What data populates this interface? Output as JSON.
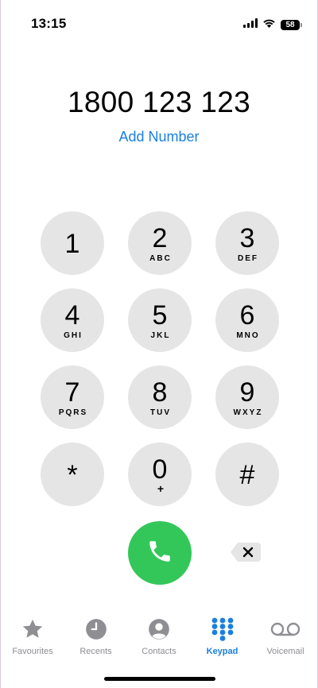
{
  "status_bar": {
    "time": "13:15",
    "battery": "58"
  },
  "dialer": {
    "number": "1800 123 123",
    "add_number_label": "Add Number"
  },
  "keypad": {
    "keys": [
      {
        "digit": "1",
        "letters": ""
      },
      {
        "digit": "2",
        "letters": "ABC"
      },
      {
        "digit": "3",
        "letters": "DEF"
      },
      {
        "digit": "4",
        "letters": "GHI"
      },
      {
        "digit": "5",
        "letters": "JKL"
      },
      {
        "digit": "6",
        "letters": "MNO"
      },
      {
        "digit": "7",
        "letters": "PQRS"
      },
      {
        "digit": "8",
        "letters": "TUV"
      },
      {
        "digit": "9",
        "letters": "WXYZ"
      },
      {
        "digit": "*",
        "letters": ""
      },
      {
        "digit": "0",
        "letters": "+"
      },
      {
        "digit": "#",
        "letters": ""
      }
    ]
  },
  "tabs": [
    {
      "label": "Favourites",
      "icon": "star-icon"
    },
    {
      "label": "Recents",
      "icon": "clock-icon"
    },
    {
      "label": "Contacts",
      "icon": "person-circle-icon"
    },
    {
      "label": "Keypad",
      "icon": "keypad-icon"
    },
    {
      "label": "Voicemail",
      "icon": "voicemail-icon"
    }
  ],
  "colors": {
    "accent": "#1a7fe0",
    "call_green": "#33c759",
    "key_gray": "#e5e5e5",
    "inactive_tab": "#8e8e93"
  }
}
